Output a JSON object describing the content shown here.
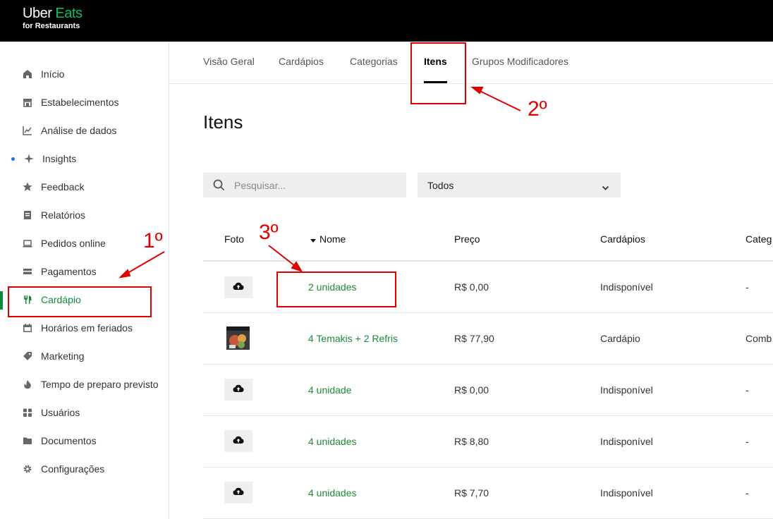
{
  "brand": {
    "line1_a": "Uber",
    "line1_b": "Eats",
    "line2": "for Restaurants",
    "accent": "#06c167"
  },
  "sidebar": {
    "items": [
      {
        "label": "Início",
        "icon": "home-icon"
      },
      {
        "label": "Estabelecimentos",
        "icon": "store-icon"
      },
      {
        "label": "Análise de dados",
        "icon": "chart-icon"
      },
      {
        "label": "Insights",
        "icon": "sparkle-icon",
        "has_dot": true
      },
      {
        "label": "Feedback",
        "icon": "star-icon"
      },
      {
        "label": "Relatórios",
        "icon": "report-icon"
      },
      {
        "label": "Pedidos online",
        "icon": "laptop-icon"
      },
      {
        "label": "Pagamentos",
        "icon": "card-icon"
      },
      {
        "label": "Cardápio",
        "icon": "fork-knife-icon",
        "active": true
      },
      {
        "label": "Horários em feriados",
        "icon": "calendar-icon"
      },
      {
        "label": "Marketing",
        "icon": "tag-icon"
      },
      {
        "label": "Tempo de preparo previsto",
        "icon": "flame-icon"
      },
      {
        "label": "Usuários",
        "icon": "users-icon"
      },
      {
        "label": "Documentos",
        "icon": "folder-icon"
      },
      {
        "label": "Configurações",
        "icon": "gear-icon"
      }
    ]
  },
  "tabs": [
    {
      "label": "Visão Geral"
    },
    {
      "label": "Cardápios"
    },
    {
      "label": "Categorias"
    },
    {
      "label": "Itens",
      "active": true
    },
    {
      "label": "Grupos Modificadores"
    }
  ],
  "page": {
    "title": "Itens"
  },
  "filters": {
    "search_placeholder": "Pesquisar...",
    "select_value": "Todos"
  },
  "table": {
    "columns": [
      "Foto",
      "Nome",
      "Preço",
      "Cardápios",
      "Categ"
    ],
    "sort_column": "Nome",
    "rows": [
      {
        "photo": "upload",
        "name": "2 unidades",
        "price": "R$ 0,00",
        "menu": "Indisponível",
        "category": "-"
      },
      {
        "photo": "image",
        "name": "4 Temakis + 2 Refris",
        "price": "R$ 77,90",
        "menu": "Cardápio",
        "category": "Comb"
      },
      {
        "photo": "upload",
        "name": "4 unidade",
        "price": "R$ 0,00",
        "menu": "Indisponível",
        "category": "-"
      },
      {
        "photo": "upload",
        "name": "4 unidades",
        "price": "R$ 8,80",
        "menu": "Indisponível",
        "category": "-"
      },
      {
        "photo": "upload",
        "name": "4 unidades",
        "price": "R$ 7,70",
        "menu": "Indisponível",
        "category": "-"
      }
    ]
  },
  "annotations": [
    {
      "label": "1º",
      "color": "#e00000"
    },
    {
      "label": "2º",
      "color": "#e00000"
    },
    {
      "label": "3º",
      "color": "#e00000"
    }
  ],
  "colors": {
    "active_green": "#108a3e",
    "link_green": "#1e8a3a",
    "insight_dot": "#276ef1"
  }
}
